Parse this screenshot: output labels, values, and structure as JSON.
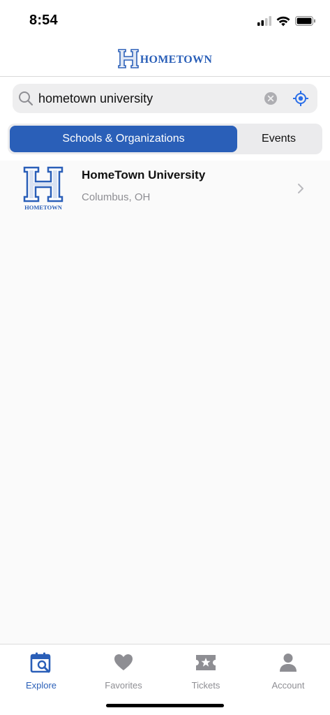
{
  "status_bar": {
    "time": "8:54"
  },
  "header": {
    "brand": "HOMETOWN",
    "logo_letter": "H"
  },
  "search": {
    "value": "hometown university",
    "placeholder": "Search"
  },
  "segments": [
    {
      "label": "Schools & Organizations",
      "active": true
    },
    {
      "label": "Events",
      "active": false
    }
  ],
  "results": [
    {
      "name": "HomeTown University",
      "location": "Columbus, OH",
      "logo_caption": "HOMETOWN",
      "logo_letter": "H"
    }
  ],
  "tabs": [
    {
      "label": "Explore",
      "icon": "calendar-search-icon",
      "active": true
    },
    {
      "label": "Favorites",
      "icon": "heart-icon",
      "active": false
    },
    {
      "label": "Tickets",
      "icon": "ticket-star-icon",
      "active": false
    },
    {
      "label": "Account",
      "icon": "person-icon",
      "active": false
    }
  ],
  "colors": {
    "accent": "#2a5fb8",
    "inactive": "#8e8e93",
    "background": "#fafafa"
  }
}
